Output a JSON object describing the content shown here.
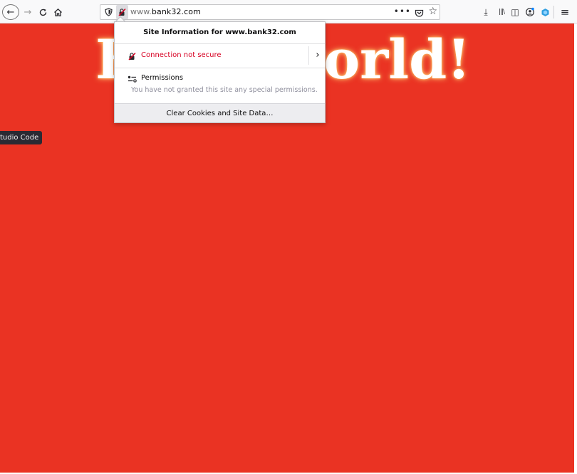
{
  "toolbar": {
    "back_icon": "back-arrow-icon",
    "forward_icon": "forward-arrow-icon",
    "reload_icon": "reload-icon",
    "home_icon": "home-icon",
    "back_glyph": "←",
    "forward_glyph": "→",
    "reload_glyph": "C",
    "home_glyph": "⌂"
  },
  "urlbar": {
    "prefix": "www.",
    "domain": "bank32.com",
    "more_glyph": "•••",
    "star_glyph": "☆"
  },
  "right_toolbar": {
    "download_glyph": "⤓",
    "library_glyph": "|||\\",
    "sidebar_glyph": "◫",
    "menu_glyph": "≡"
  },
  "page": {
    "background_color": "#ea3323",
    "headline": "Hello world!",
    "tooltip": "tudio Code"
  },
  "site_info_popup": {
    "title": "Site Information for www.bank32.com",
    "connection_label": "Connection not secure",
    "connection_color": "#d70022",
    "arrow_glyph": "›",
    "permissions_label": "Permissions",
    "permissions_desc": "You have not granted this site any special permissions.",
    "clear_button": "Clear Cookies and Site Data…"
  }
}
